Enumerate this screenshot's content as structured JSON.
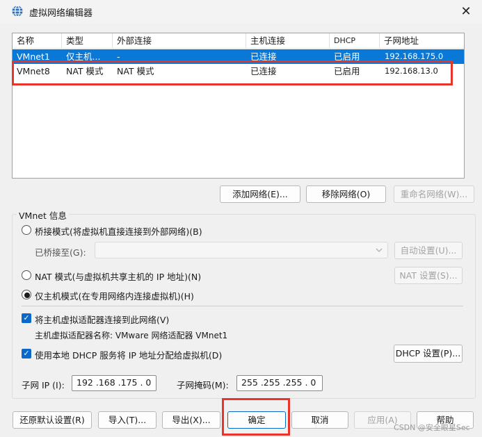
{
  "window": {
    "title": "虚拟网络编辑器",
    "close_glyph": "✕",
    "icon": "network-globe-icon"
  },
  "table": {
    "headers": [
      "名称",
      "类型",
      "外部连接",
      "主机连接",
      "DHCP",
      "子网地址"
    ],
    "rows": [
      {
        "name": "VMnet1",
        "type": "仅主机...",
        "external": "-",
        "host": "已连接",
        "dhcp": "已启用",
        "subnet": "192.168.175.0",
        "selected": true
      },
      {
        "name": "VMnet8",
        "type": "NAT 模式",
        "external": "NAT 模式",
        "host": "已连接",
        "dhcp": "已启用",
        "subnet": "192.168.13.0",
        "selected": false
      }
    ]
  },
  "list_buttons": {
    "add": "添加网络(E)...",
    "remove": "移除网络(O)",
    "rename": "重命名网络(W)..."
  },
  "vmnet_info": {
    "group_title": "VMnet 信息",
    "bridged_label": "桥接模式(将虚拟机直接连接到外部网络)(B)",
    "bridged_to_label": "已桥接至(G):",
    "auto_settings": "自动设置(U)...",
    "nat_label": "NAT 模式(与虚拟机共享主机的 IP 地址)(N)",
    "nat_settings": "NAT 设置(S)...",
    "hostonly_label": "仅主机模式(在专用网络内连接虚拟机)(H)",
    "selected_mode": "hostonly",
    "connect_adapter_label": "将主机虚拟适配器连接到此网络(V)",
    "adapter_name_label": "主机虚拟适配器名称: VMware 网络适配器 VMnet1",
    "dhcp_label": "使用本地 DHCP 服务将 IP 地址分配给虚拟机(D)",
    "dhcp_settings": "DHCP 设置(P)...",
    "subnet_ip_label": "子网 IP (I):",
    "subnet_ip_value": "192 .168 .175 . 0",
    "subnet_mask_label": "子网掩码(M):",
    "subnet_mask_value": "255 .255 .255 . 0"
  },
  "footer": {
    "restore": "还原默认设置(R)",
    "import": "导入(T)...",
    "export": "导出(X)...",
    "ok": "确定",
    "cancel": "取消",
    "apply": "应用(A)",
    "help": "帮助"
  },
  "watermark": "CSDN @安全眼星Sec",
  "colors": {
    "selection": "#0a78d7",
    "highlight_box": "#e8352b",
    "checkbox": "#0a68c8"
  }
}
